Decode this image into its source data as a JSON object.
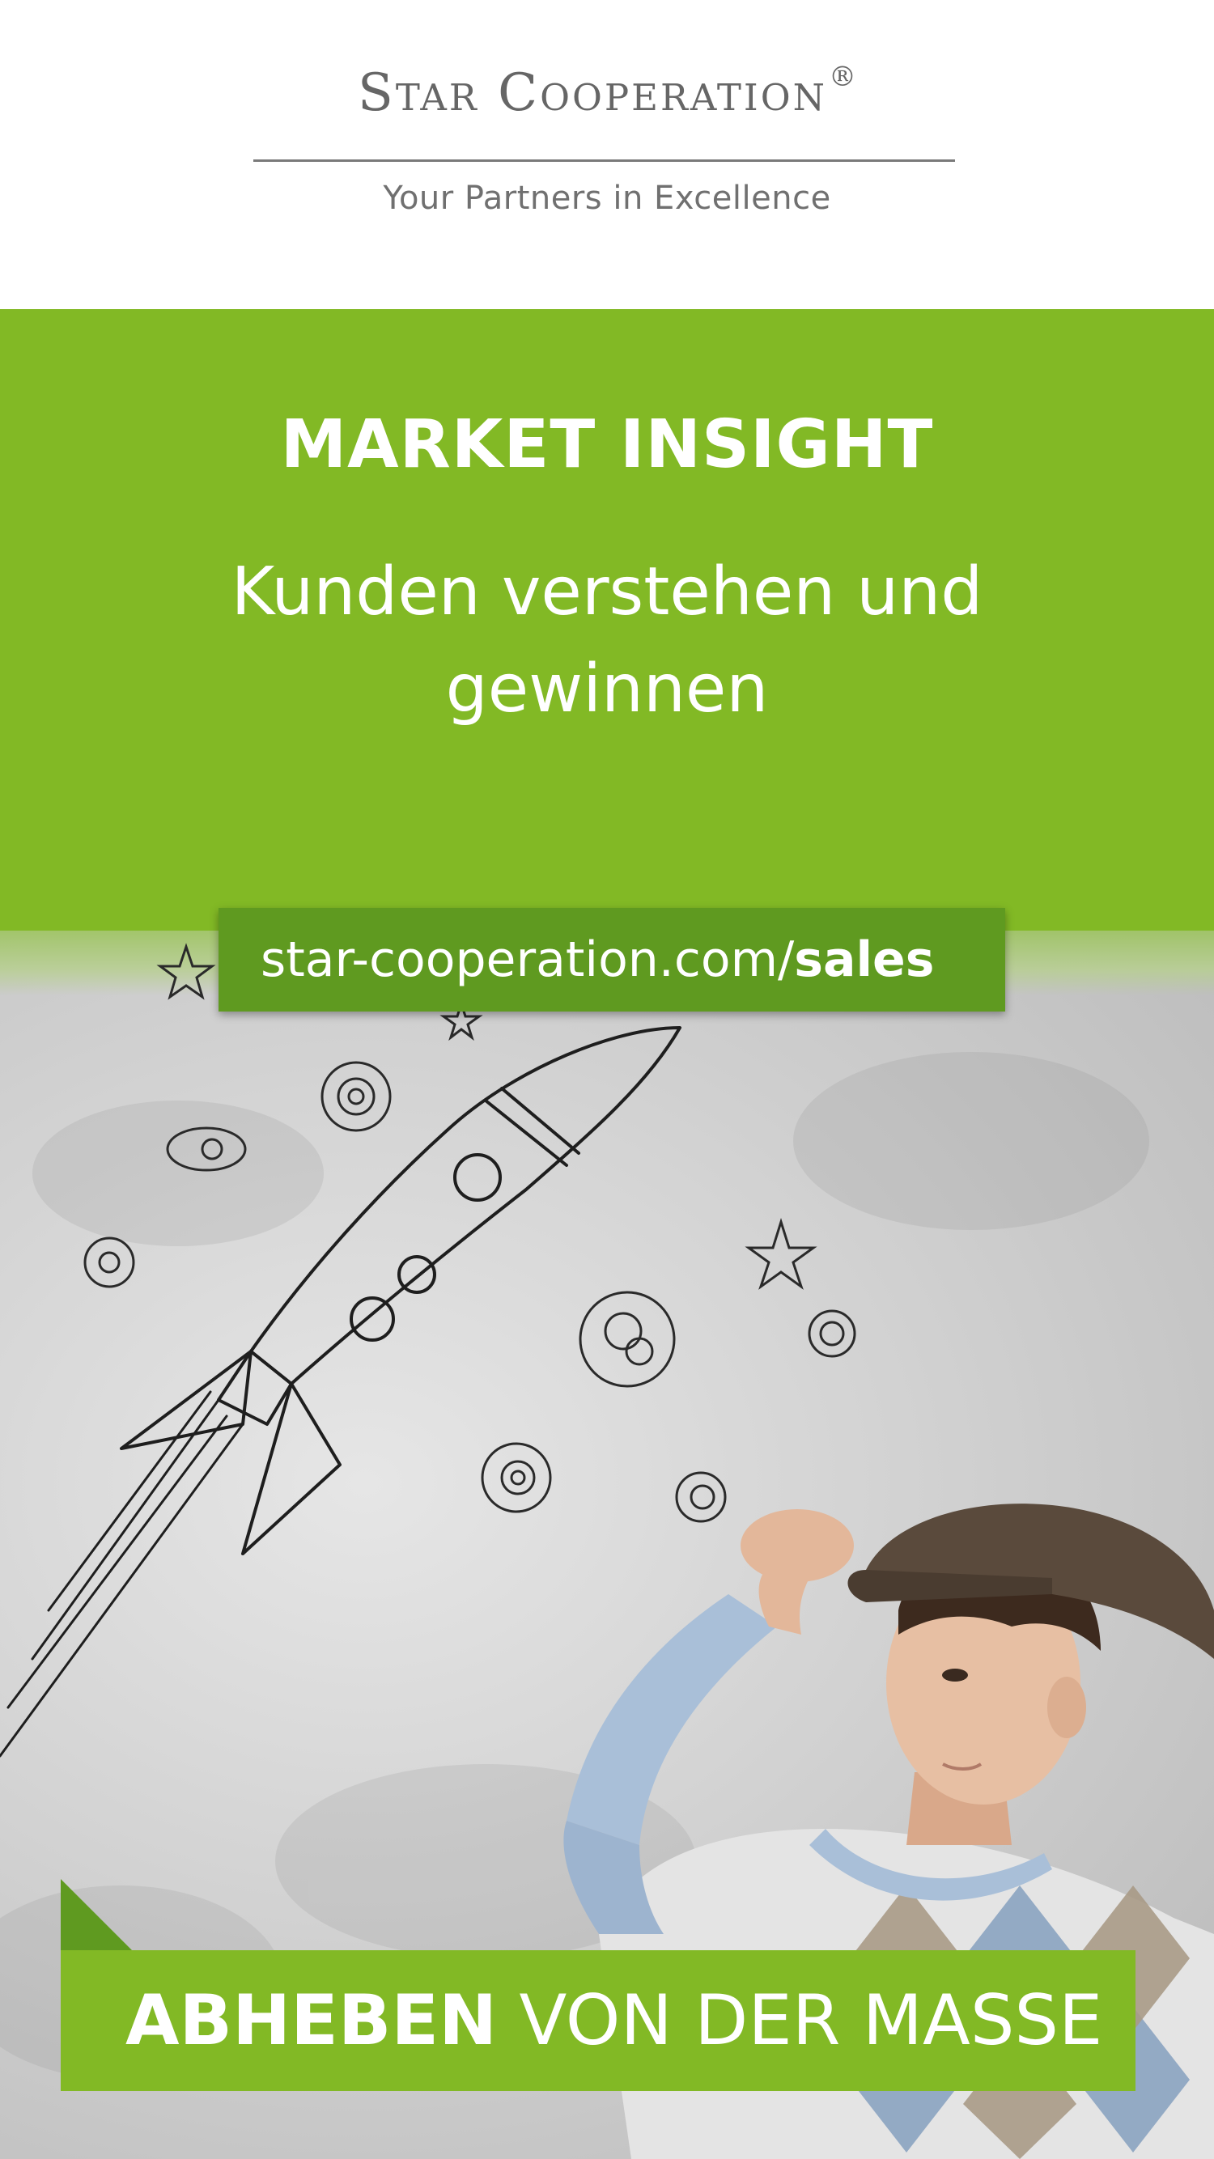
{
  "header": {
    "brand_name": "Star Cooperation",
    "brand_mark": "®",
    "tagline": "Your Partners in Excellence"
  },
  "headline": {
    "title": "MARKET INSIGHT",
    "subtitle": "Kunden verstehen und gewinnen"
  },
  "url": {
    "domain": "star-cooperation.com/",
    "path": "sales"
  },
  "banner": {
    "bold": "ABHEBEN",
    "rest": "VON DER MASSE"
  },
  "colors": {
    "brand_green": "#82b925",
    "dark_green": "#5f9a20",
    "text_gray": "#666666"
  },
  "image": {
    "description_icons": [
      "rocket-sketch",
      "planet-sketch",
      "star-sketch",
      "boy-with-cap"
    ]
  }
}
